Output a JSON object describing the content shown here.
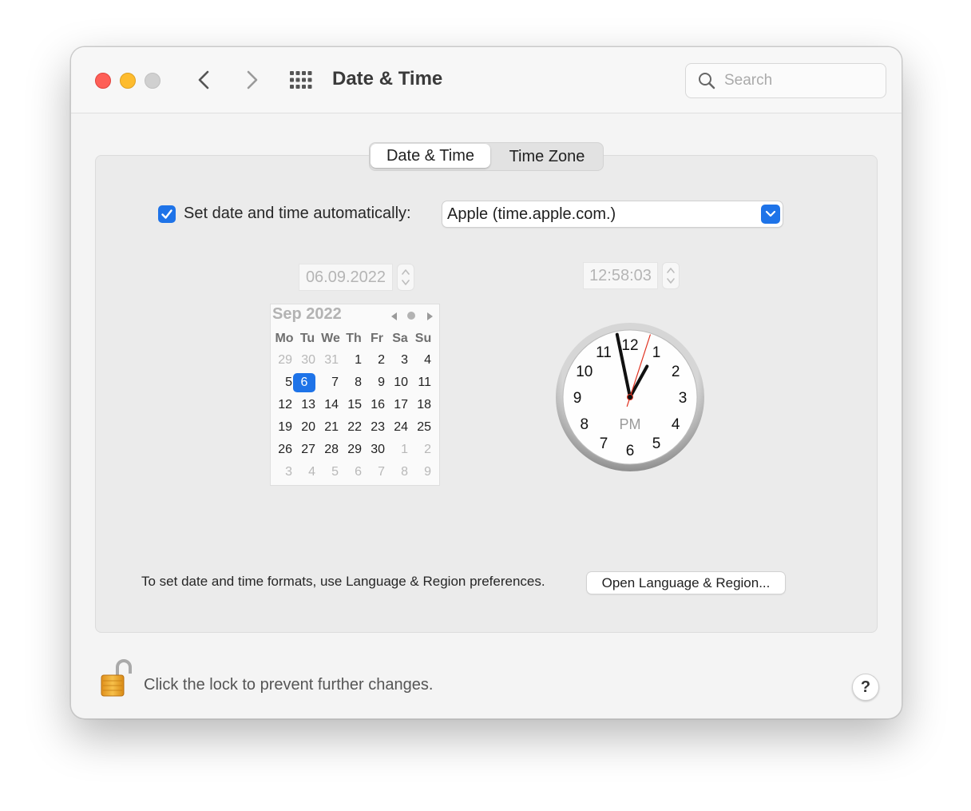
{
  "window": {
    "title": "Date & Time",
    "search": {
      "placeholder": "Search",
      "value": ""
    }
  },
  "tabs": [
    {
      "label": "Date & Time",
      "selected": true
    },
    {
      "label": "Time Zone",
      "selected": false
    }
  ],
  "auto": {
    "label": "Set date and time automatically:",
    "checked": true,
    "server": "Apple (time.apple.com.)"
  },
  "date_field": "06.09.2022",
  "time_field": "12:58:03",
  "calendar": {
    "title": "Sep 2022",
    "weekdays": [
      "Mo",
      "Tu",
      "We",
      "Th",
      "Fr",
      "Sa",
      "Su"
    ],
    "weeks": [
      [
        "29",
        "30",
        "31",
        "1",
        "2",
        "3",
        "4"
      ],
      [
        "5",
        "6",
        "7",
        "8",
        "9",
        "10",
        "11"
      ],
      [
        "12",
        "13",
        "14",
        "15",
        "16",
        "17",
        "18"
      ],
      [
        "19",
        "20",
        "21",
        "22",
        "23",
        "24",
        "25"
      ],
      [
        "26",
        "27",
        "28",
        "29",
        "30",
        "1",
        "2"
      ],
      [
        "3",
        "4",
        "5",
        "6",
        "7",
        "8",
        "9"
      ]
    ],
    "selected_day": "6"
  },
  "clock": {
    "meridiem": "PM",
    "numbers": [
      "12",
      "1",
      "2",
      "3",
      "4",
      "5",
      "6",
      "7",
      "8",
      "9",
      "10",
      "11"
    ]
  },
  "footer": {
    "formats_text": "To set date and time formats, use Language & Region preferences.",
    "open_button": "Open Language & Region...",
    "lock_text": "Click the lock to prevent further changes.",
    "help": "?"
  },
  "colors": {
    "accent": "#1e73e8",
    "second_hand": "#e0301e"
  },
  "icons": [
    "back-chevron-icon",
    "forward-chevron-icon",
    "grid-icon",
    "search-icon",
    "checkmark-icon",
    "chevron-down-icon",
    "stepper-icon",
    "unlocked-lock-icon",
    "help-icon"
  ]
}
